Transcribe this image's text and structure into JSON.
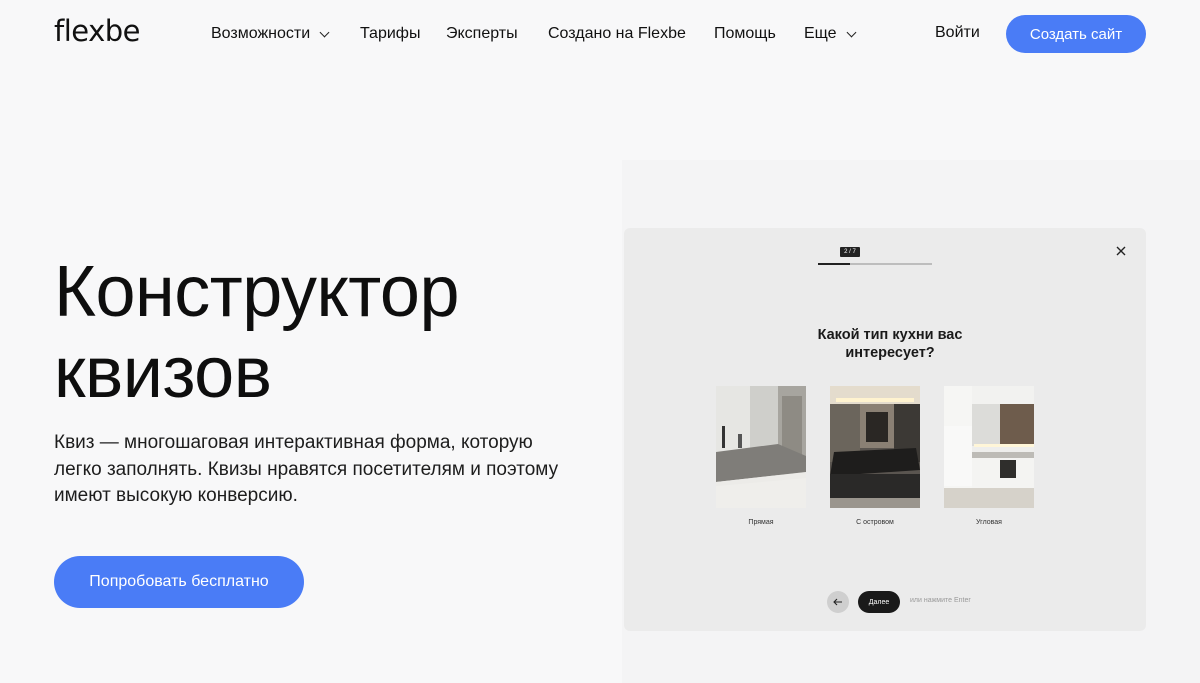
{
  "header": {
    "logo": "flexbe",
    "nav": [
      {
        "label": "Возможности",
        "dropdown": true
      },
      {
        "label": "Тарифы",
        "dropdown": false
      },
      {
        "label": "Эксперты",
        "dropdown": false
      },
      {
        "label": "Создано на Flexbe",
        "dropdown": false
      },
      {
        "label": "Помощь",
        "dropdown": false
      },
      {
        "label": "Еще",
        "dropdown": true
      }
    ],
    "login": "Войти",
    "create_site": "Создать сайт"
  },
  "hero": {
    "title_line1": "Конструктор",
    "title_line2": "квизов",
    "description": "Квиз — многошаговая интерактивная форма, которую легко заполнять. Квизы нравятся посетителям и поэтому имеют высокую конверсию.",
    "cta": "Попробовать бесплатно"
  },
  "quiz_preview": {
    "step": "2 / 7",
    "progress": 0.28,
    "question": "Какой тип кухни вас интересует?",
    "options": [
      {
        "label": "Прямая"
      },
      {
        "label": "С островом"
      },
      {
        "label": "Угловая"
      }
    ],
    "next_label": "Далее",
    "hint": "или нажмите Enter"
  },
  "colors": {
    "accent": "#4a7cf6",
    "background": "#f8f8f9",
    "quiz_bg": "#ebebeb",
    "dark": "#1a1a1a"
  },
  "icons": [
    "chevron-down-icon",
    "close-icon",
    "arrow-left-icon"
  ]
}
